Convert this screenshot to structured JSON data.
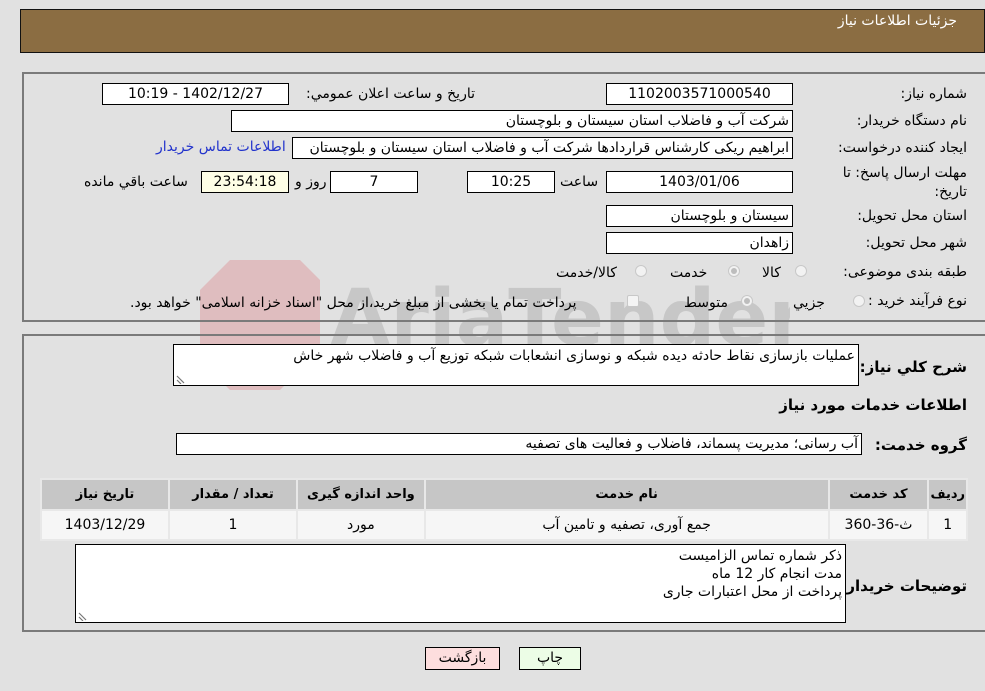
{
  "header": {
    "title": "جزئیات اطلاعات نیاز"
  },
  "form": {
    "need_number_label": "شماره نیاز:",
    "need_number": "1102003571000540",
    "announce_label": "تاریخ و ساعت اعلان عمومي:",
    "announce_value": "1402/12/27 - 10:19",
    "buyer_org_label": "نام دستگاه خریدار:",
    "buyer_org": "شرکت آب و فاضلاب استان سیستان و بلوچستان",
    "requester_label": "ایجاد کننده درخواست:",
    "requester": "ابراهیم ریکی کارشناس قراردادها شرکت آب و فاضلاب استان سیستان و بلوچستان",
    "contact_link": "اطلاعات تماس خریدار",
    "deadline_label": "مهلت ارسال پاسخ: تا تاریخ:",
    "deadline_date": "1403/01/06",
    "time_label": "ساعت",
    "deadline_time": "10:25",
    "days_value": "7",
    "days_label": "روز و",
    "remaining_time": "23:54:18",
    "remaining_label": "ساعت باقي مانده",
    "province_label": "استان محل تحویل:",
    "province": "سیستان و بلوچستان",
    "city_label": "شهر محل تحویل:",
    "city": "زاهدان",
    "category_label": "طبقه بندی موضوعی:",
    "category_options": [
      {
        "label": "کالا",
        "selected": false
      },
      {
        "label": "خدمت",
        "selected": true
      },
      {
        "label": "کالا/خدمت",
        "selected": false
      }
    ],
    "process_label": "نوع فرآیند خرید :",
    "process_options": [
      {
        "label": "جزيي",
        "selected": false
      },
      {
        "label": "متوسط",
        "selected": true
      }
    ],
    "treasury_note": "پرداخت تمام یا بخشی از مبلغ خرید،از محل \"اسناد خزانه اسلامی\" خواهد بود.",
    "treasury_checked": false
  },
  "details": {
    "description_label": "شرح کلي نیاز:",
    "description": "عملیات بازسازی نقاط حادثه دیده شبکه و نوسازی انشعابات شبکه توزیع آب و فاضلاب شهر خاش",
    "services_heading": "اطلاعات خدمات مورد نیاز",
    "service_group_label": "گروه خدمت:",
    "service_group": "آب رسانی؛ مدیریت پسماند، فاضلاب و فعالیت های تصفیه",
    "table": {
      "headers": [
        "ردیف",
        "کد خدمت",
        "نام خدمت",
        "واحد اندازه گیری",
        "تعداد / مقدار",
        "تاریخ نیاز"
      ],
      "rows": [
        [
          "1",
          "ث-36-360",
          "جمع آوری، تصفیه و تامین آب",
          "مورد",
          "1",
          "1403/12/29"
        ]
      ]
    },
    "buyer_notes_label": "توضیحات خریدار:",
    "buyer_notes": [
      "ذکر شماره تماس الزامیست",
      "مدت انجام کار  12 ماه",
      "پرداخت از محل اعتبارات جاری"
    ]
  },
  "buttons": {
    "print": "چاپ",
    "back": "بازگشت"
  },
  "watermark": {
    "text": "AriaTender.neT"
  },
  "colors": {
    "header_bg": "#8b6d42",
    "link": "#2233cc",
    "back_bg": "#fddede",
    "print_bg": "#ecfde6"
  }
}
